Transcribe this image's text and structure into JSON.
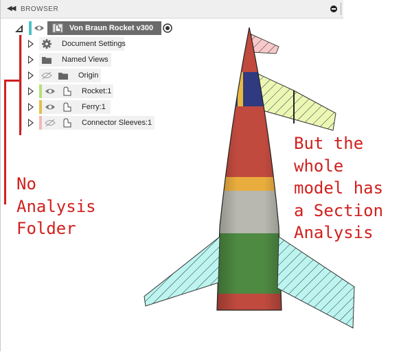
{
  "panel": {
    "title": "BROWSER",
    "collapse_icon": "double-left-arrow-icon"
  },
  "tree": {
    "root": {
      "label": "Von Braun Rocket v300",
      "accent": "#4fc1c6"
    },
    "items": [
      {
        "label": "Document Settings",
        "icon": "gear-icon"
      },
      {
        "label": "Named Views",
        "icon": "folder-icon"
      },
      {
        "label": "Origin",
        "icon": "folder-icon",
        "visibility": "hidden"
      },
      {
        "label": "Rocket:1",
        "icon": "component-icon",
        "visibility": "visible",
        "color": "#b5e07a"
      },
      {
        "label": "Ferry:1",
        "icon": "component-icon",
        "visibility": "visible",
        "color": "#e0c14a"
      },
      {
        "label": "Connector Sleeves:1",
        "icon": "component-icon",
        "visibility": "hidden",
        "color": "#f3b8b4"
      }
    ]
  },
  "annotations": {
    "left": "No\nAnalysis\nFolder",
    "right": "But the\nwhole\nmodel has\na Section\nAnalysis",
    "color": "#d0201e"
  }
}
